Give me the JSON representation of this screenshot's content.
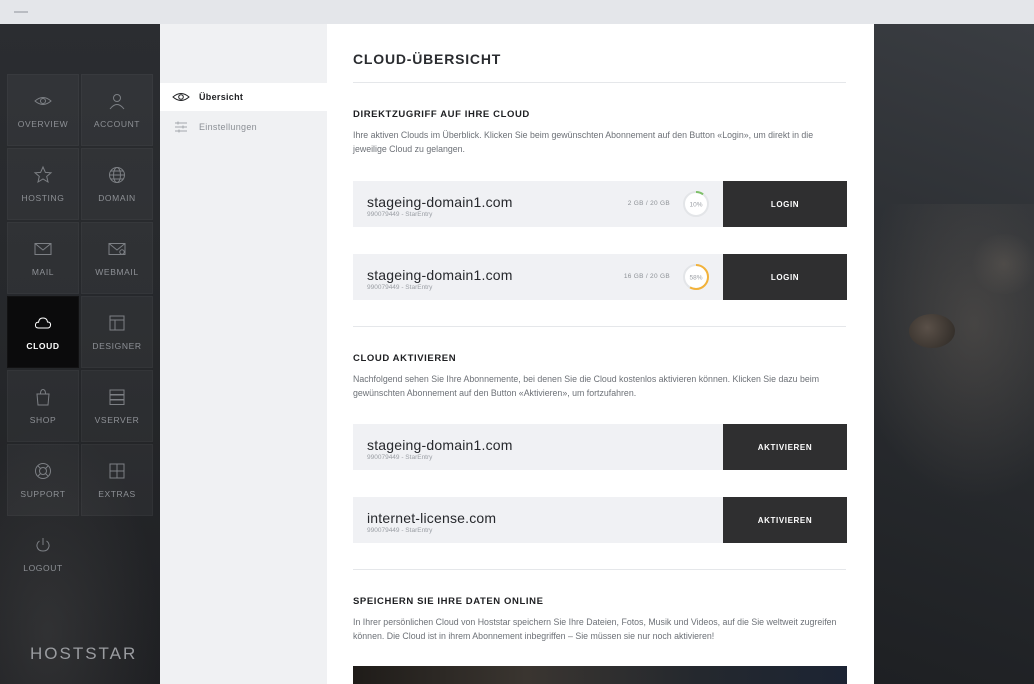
{
  "sidebar": {
    "items": [
      {
        "label": "OVERVIEW",
        "icon": "eye-icon"
      },
      {
        "label": "ACCOUNT",
        "icon": "user-icon"
      },
      {
        "label": "HOSTING",
        "icon": "star-icon"
      },
      {
        "label": "DOMAIN",
        "icon": "globe-icon"
      },
      {
        "label": "MAIL",
        "icon": "envelope-icon"
      },
      {
        "label": "WEBMAIL",
        "icon": "webmail-icon"
      },
      {
        "label": "CLOUD",
        "icon": "cloud-icon",
        "active": true
      },
      {
        "label": "DESIGNER",
        "icon": "layout-icon"
      },
      {
        "label": "SHOP",
        "icon": "shopping-bag-icon"
      },
      {
        "label": "VSERVER",
        "icon": "server-icon"
      },
      {
        "label": "SUPPORT",
        "icon": "lifebuoy-icon"
      },
      {
        "label": "EXTRAS",
        "icon": "grid-icon"
      },
      {
        "label": "LOGOUT",
        "icon": "power-icon"
      }
    ],
    "brand": "HOSTSTAR"
  },
  "subnav": {
    "items": [
      {
        "label": "Übersicht",
        "icon": "eye-icon",
        "active": true
      },
      {
        "label": "Einstellungen",
        "icon": "sliders-icon",
        "active": false
      }
    ]
  },
  "main": {
    "title": "CLOUD-ÜBERSICHT",
    "section1": {
      "title": "DIREKTZUGRIFF AUF IHRE CLOUD",
      "text": "Ihre aktiven Clouds im Überblick. Klicken Sie beim gewünschten Abonnement auf den Button «Login», um direkt in die jeweilige Cloud zu gelangen.",
      "clouds": [
        {
          "domain": "stageing-domain1.com",
          "sub": "990079449 - StarEntry",
          "usage": "2 GB / 20 GB",
          "percent_label": "10%",
          "percent": 10,
          "ring_color": "#7fc06a",
          "button": "LOGIN"
        },
        {
          "domain": "stageing-domain1.com",
          "sub": "990079449 - StarEntry",
          "usage": "16 GB / 20 GB",
          "percent_label": "58%",
          "percent": 58,
          "ring_color": "#f2b23a",
          "button": "LOGIN"
        }
      ]
    },
    "section2": {
      "title": "CLOUD AKTIVIEREN",
      "text": "Nachfolgend sehen Sie Ihre Abonnemente, bei denen Sie die Cloud kostenlos aktivieren können. Klicken Sie dazu beim gewünschten Abonnement auf den Button «Aktivieren», um fortzufahren.",
      "subscriptions": [
        {
          "domain": "stageing-domain1.com",
          "sub": "990079449 - StarEntry",
          "button": "AKTIVIEREN"
        },
        {
          "domain": "internet-license.com",
          "sub": "990079449 - StarEntry",
          "button": "AKTIVIEREN"
        }
      ]
    },
    "section3": {
      "title": "SPEICHERN SIE IHRE DATEN ONLINE",
      "text": "In Ihrer persönlichen Cloud von Hoststar speichern Sie Ihre Dateien, Fotos, Musik und Videos, auf die Sie weltweit zugreifen können. Die Cloud ist in ihrem Abonnement inbegriffen – Sie müssen sie nur noch aktivieren!"
    }
  }
}
